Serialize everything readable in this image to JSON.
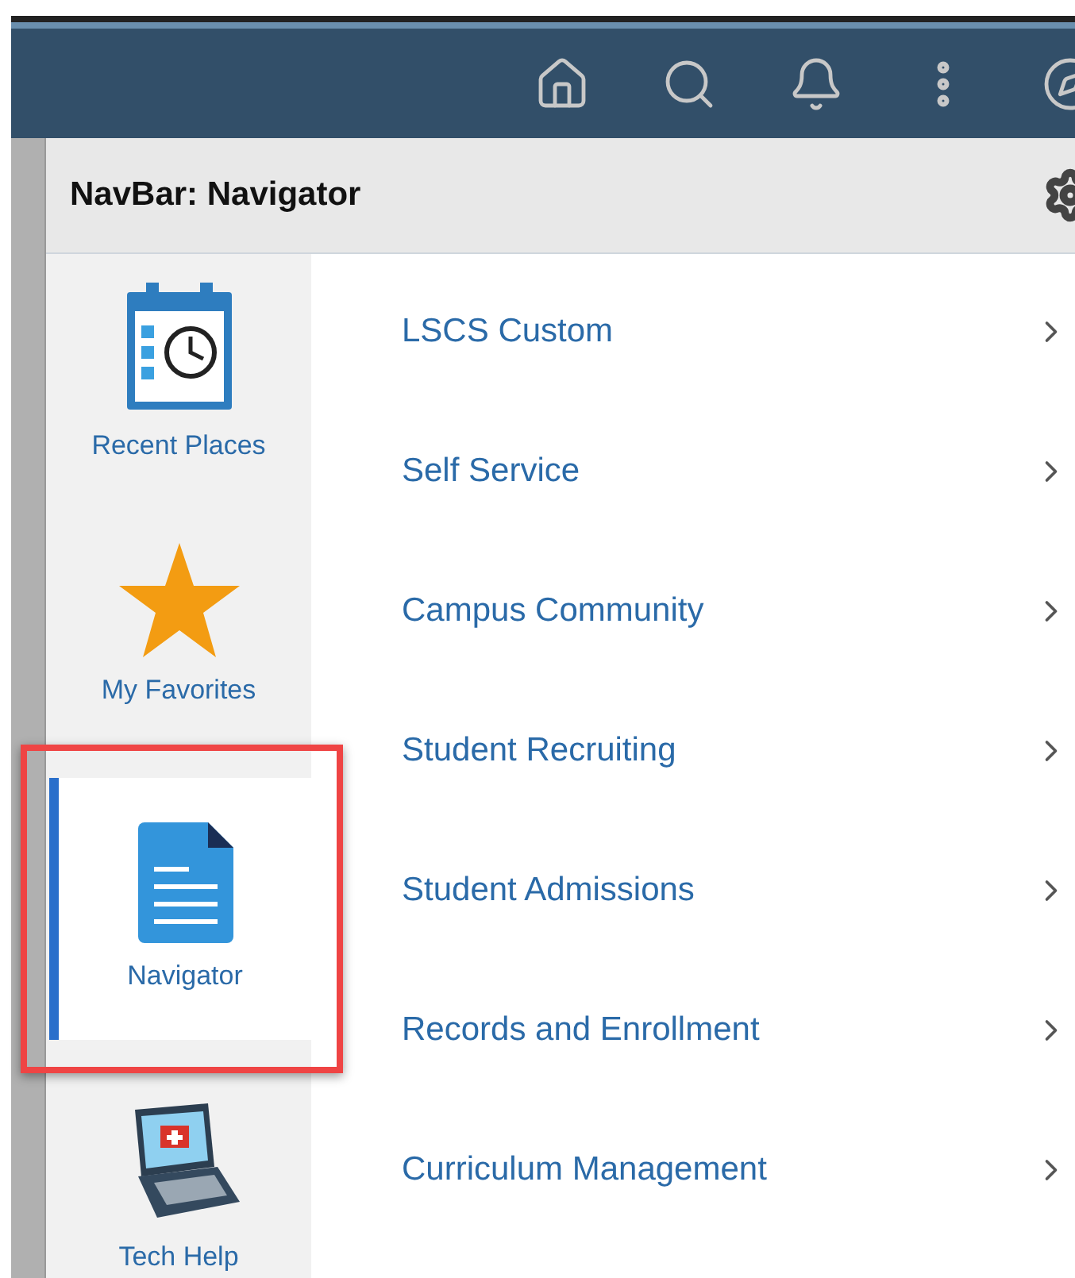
{
  "panel": {
    "title": "NavBar: Navigator"
  },
  "sidebar": {
    "items": [
      {
        "label": "Recent Places",
        "kind": "calendar",
        "selected": false
      },
      {
        "label": "My Favorites",
        "kind": "star",
        "selected": false
      },
      {
        "label": "Navigator",
        "kind": "document",
        "selected": true
      },
      {
        "label": "Tech Help",
        "kind": "laptop",
        "selected": false
      }
    ]
  },
  "menu": {
    "items": [
      {
        "label": "LSCS Custom"
      },
      {
        "label": "Self Service"
      },
      {
        "label": "Campus Community"
      },
      {
        "label": "Student Recruiting"
      },
      {
        "label": "Student Admissions"
      },
      {
        "label": "Records and Enrollment"
      },
      {
        "label": "Curriculum Management"
      }
    ]
  }
}
